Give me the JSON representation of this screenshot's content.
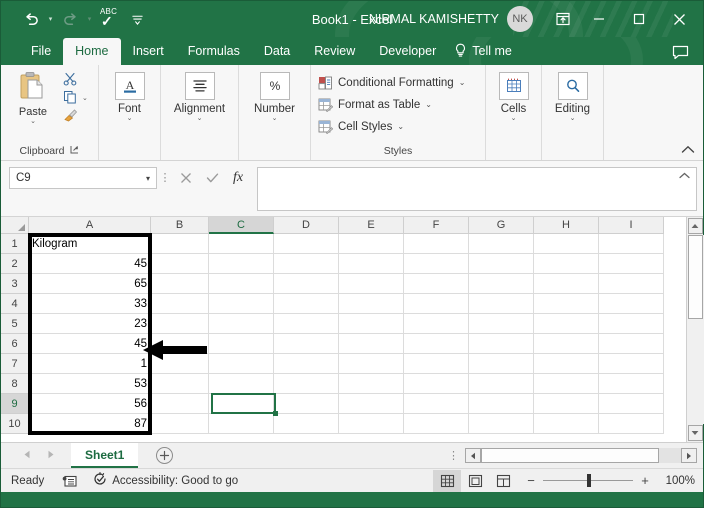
{
  "window": {
    "title": "Book1  -  Excel",
    "account_name": "NIRMAL KAMISHETTY",
    "account_initials": "NK",
    "minimize_label": "—",
    "maximize_label": "□",
    "close_label": "✕",
    "ribbon_display_label": "▣"
  },
  "quick_access": {
    "undo_label": "↺",
    "redo_label": "↻",
    "spelling_label": "ABC",
    "spelling_check": "✓",
    "customize_label": "⩲"
  },
  "tabs": [
    {
      "label": "File",
      "active": false
    },
    {
      "label": "Home",
      "active": true
    },
    {
      "label": "Insert",
      "active": false
    },
    {
      "label": "Formulas",
      "active": false
    },
    {
      "label": "Data",
      "active": false
    },
    {
      "label": "Review",
      "active": false
    },
    {
      "label": "Developer",
      "active": false
    }
  ],
  "tell_me": {
    "label": "Tell me",
    "bulb": "♡"
  },
  "ribbon": {
    "clipboard": {
      "group_label": "Clipboard",
      "paste_label": "Paste",
      "cut_label": "Cut",
      "copy_label": "Copy",
      "format_painter_label": "Format Painter",
      "dialog_launcher": "⌐"
    },
    "font": {
      "group_label": "",
      "label": "Font",
      "icon": "A"
    },
    "alignment": {
      "label": "Alignment",
      "icon": "≡"
    },
    "number": {
      "label": "Number",
      "icon": "%"
    },
    "styles": {
      "group_label": "Styles",
      "conditional_formatting": "Conditional Formatting",
      "format_as_table": "Format as Table",
      "cell_styles": "Cell Styles"
    },
    "cells": {
      "label": "Cells"
    },
    "editing": {
      "label": "Editing",
      "icon": "⌕"
    },
    "collapse_label": "⌃"
  },
  "formula_bar": {
    "name_box_value": "C9",
    "cancel_label": "✕",
    "enter_label": "✓",
    "function_label": "fx",
    "formula_value": "",
    "expand_label": "⌃"
  },
  "grid": {
    "columns": [
      "A",
      "B",
      "C",
      "D",
      "E",
      "F",
      "G",
      "H",
      "I"
    ],
    "selected_column": "C",
    "rows": [
      "1",
      "2",
      "3",
      "4",
      "5",
      "6",
      "7",
      "8",
      "9",
      "10"
    ],
    "selected_row": "9",
    "column_a_values": [
      "Kilogram",
      "45",
      "65",
      "33",
      "23",
      "45",
      "1",
      "53",
      "56",
      "87"
    ],
    "selected_cell": "C9"
  },
  "sheet_bar": {
    "prev_label": "◄",
    "next_label": "►",
    "sheet_name": "Sheet1",
    "add_sheet_label": "+",
    "dots": "⋮",
    "hs_left": "◄",
    "hs_right": "►"
  },
  "status_bar": {
    "ready_label": "Ready",
    "accessibility_label": "Accessibility: Good to go",
    "normal_view": "▦",
    "page_layout_view": "▤",
    "page_break_view": "▥",
    "zoom_out": "−",
    "zoom_in": "+",
    "zoom_level": "100%"
  },
  "colors": {
    "excel_green": "#217346",
    "accent_green": "#1d6b41",
    "ribbon_bg": "#f7f7f7"
  }
}
